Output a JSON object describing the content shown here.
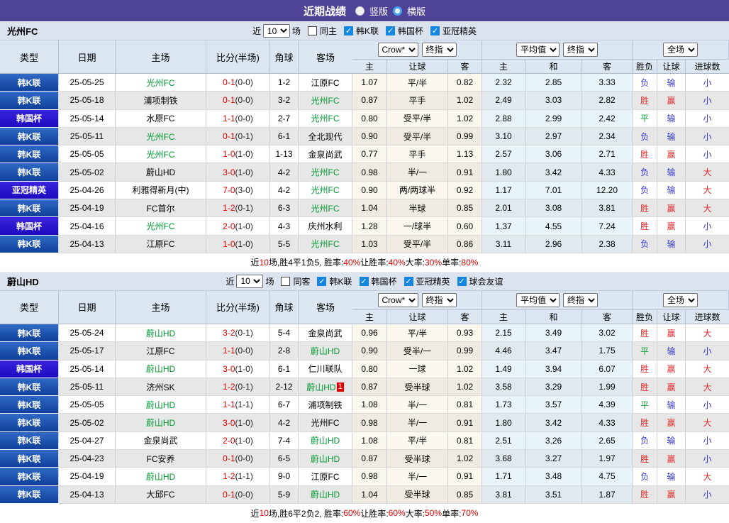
{
  "titlebar": {
    "title": "近期战绩",
    "radios": [
      {
        "label": "竖版",
        "selected": false,
        "id": "vertical-layout"
      },
      {
        "label": "横版",
        "selected": true,
        "id": "horizontal-layout"
      }
    ]
  },
  "table_header": {
    "cols": [
      "类型",
      "日期",
      "主场",
      "比分(半场)",
      "角球",
      "客场"
    ],
    "groups": [
      {
        "selects": [
          {
            "label": "Crow*",
            "id": "odds-company-select"
          },
          {
            "label": "终指",
            "id": "final-odds-select"
          }
        ]
      },
      {
        "selects": [
          {
            "label": "平均值",
            "id": "average-odds-select"
          },
          {
            "label": "终指",
            "id": "final-odds-select-2"
          }
        ]
      },
      {
        "selects": [
          {
            "label": "全场",
            "id": "scope-select"
          }
        ]
      }
    ],
    "subs": [
      "主",
      "让球",
      "客",
      "主",
      "和",
      "客",
      "胜负",
      "让球",
      "进球数"
    ]
  },
  "sections": [
    {
      "team": "光州FC",
      "filter": {
        "near": "近",
        "count": "10",
        "games": "场",
        "checkboxes": [
          {
            "label": "同主",
            "checked": false,
            "id": "same-home"
          },
          {
            "label": "韩K联",
            "checked": true,
            "id": "k-league"
          },
          {
            "label": "韩国杯",
            "checked": true,
            "id": "korea-cup"
          },
          {
            "label": "亚冠精英",
            "checked": true,
            "id": "acl-elite"
          }
        ]
      },
      "rows": [
        {
          "lg": "韩K联",
          "dt": "25-05-25",
          "hm": "光州FC",
          "hf": 1,
          "sc": "0-1",
          "ht": "(0-0)",
          "cn": "1-2",
          "aw": "江原FC",
          "af": 0,
          "bd": "",
          "o1": "1.07",
          "hc": "平/半",
          "o2": "0.82",
          "m1": "2.32",
          "m2": "2.85",
          "m3": "3.33",
          "r1": "负",
          "r2": "输",
          "r3": "小"
        },
        {
          "lg": "韩K联",
          "dt": "25-05-18",
          "hm": "浦项制铁",
          "hf": 0,
          "sc": "0-1",
          "ht": "(0-0)",
          "cn": "3-2",
          "aw": "光州FC",
          "af": 1,
          "bd": "",
          "o1": "0.87",
          "hc": "平手",
          "o2": "1.02",
          "m1": "2.49",
          "m2": "3.03",
          "m3": "2.82",
          "r1": "胜",
          "r2": "赢",
          "r3": "小"
        },
        {
          "lg": "韩国杯",
          "dt": "25-05-14",
          "hm": "水原FC",
          "hf": 0,
          "sc": "1-1",
          "ht": "(0-0)",
          "cn": "2-7",
          "aw": "光州FC",
          "af": 1,
          "bd": "",
          "o1": "0.80",
          "hc": "受平/半",
          "o2": "1.02",
          "m1": "2.88",
          "m2": "2.99",
          "m3": "2.42",
          "r1": "平",
          "r2": "输",
          "r3": "小"
        },
        {
          "lg": "韩K联",
          "dt": "25-05-11",
          "hm": "光州FC",
          "hf": 1,
          "sc": "0-1",
          "ht": "(0-1)",
          "cn": "6-1",
          "aw": "全北现代",
          "af": 0,
          "bd": "",
          "o1": "0.90",
          "hc": "受平/半",
          "o2": "0.99",
          "m1": "3.10",
          "m2": "2.97",
          "m3": "2.34",
          "r1": "负",
          "r2": "输",
          "r3": "小"
        },
        {
          "lg": "韩K联",
          "dt": "25-05-05",
          "hm": "光州FC",
          "hf": 1,
          "sc": "1-0",
          "ht": "(1-0)",
          "cn": "1-13",
          "aw": "金泉尚武",
          "af": 0,
          "bd": "",
          "o1": "0.77",
          "hc": "平手",
          "o2": "1.13",
          "m1": "2.57",
          "m2": "3.06",
          "m3": "2.71",
          "r1": "胜",
          "r2": "赢",
          "r3": "小"
        },
        {
          "lg": "韩K联",
          "dt": "25-05-02",
          "hm": "蔚山HD",
          "hf": 0,
          "sc": "3-0",
          "ht": "(1-0)",
          "cn": "4-2",
          "aw": "光州FC",
          "af": 1,
          "bd": "",
          "o1": "0.98",
          "hc": "半/一",
          "o2": "0.91",
          "m1": "1.80",
          "m2": "3.42",
          "m3": "4.33",
          "r1": "负",
          "r2": "输",
          "r3": "大"
        },
        {
          "lg": "亚冠精英",
          "dt": "25-04-26",
          "hm": "利雅得新月(中)",
          "hf": 0,
          "sc": "7-0",
          "ht": "(3-0)",
          "cn": "4-2",
          "aw": "光州FC",
          "af": 1,
          "bd": "",
          "o1": "0.90",
          "hc": "两/两球半",
          "o2": "0.92",
          "m1": "1.17",
          "m2": "7.01",
          "m3": "12.20",
          "r1": "负",
          "r2": "输",
          "r3": "大"
        },
        {
          "lg": "韩K联",
          "dt": "25-04-19",
          "hm": "FC首尔",
          "hf": 0,
          "sc": "1-2",
          "ht": "(0-1)",
          "cn": "6-3",
          "aw": "光州FC",
          "af": 1,
          "bd": "",
          "o1": "1.04",
          "hc": "半球",
          "o2": "0.85",
          "m1": "2.01",
          "m2": "3.08",
          "m3": "3.81",
          "r1": "胜",
          "r2": "赢",
          "r3": "大"
        },
        {
          "lg": "韩国杯",
          "dt": "25-04-16",
          "hm": "光州FC",
          "hf": 1,
          "sc": "2-0",
          "ht": "(1-0)",
          "cn": "4-3",
          "aw": "庆州水利",
          "af": 0,
          "bd": "",
          "o1": "1.28",
          "hc": "一/球半",
          "o2": "0.60",
          "m1": "1.37",
          "m2": "4.55",
          "m3": "7.24",
          "r1": "胜",
          "r2": "赢",
          "r3": "小"
        },
        {
          "lg": "韩K联",
          "dt": "25-04-13",
          "hm": "江原FC",
          "hf": 0,
          "sc": "1-0",
          "ht": "(1-0)",
          "cn": "5-5",
          "aw": "光州FC",
          "af": 1,
          "bd": "",
          "o1": "1.03",
          "hc": "受平/半",
          "o2": "0.86",
          "m1": "3.11",
          "m2": "2.96",
          "m3": "2.38",
          "r1": "负",
          "r2": "输",
          "r3": "小"
        }
      ],
      "summary": [
        [
          "近",
          0
        ],
        [
          "10",
          1
        ],
        [
          "场,胜4平1负5, 胜率:",
          0
        ],
        [
          "40%",
          1
        ],
        [
          " 让胜率:",
          0
        ],
        [
          "40%",
          1
        ],
        [
          " 大率:",
          0
        ],
        [
          "30%",
          1
        ],
        [
          " 单率:",
          0
        ],
        [
          "80%",
          1
        ]
      ]
    },
    {
      "team": "蔚山HD",
      "filter": {
        "near": "近",
        "count": "10",
        "games": "场",
        "checkboxes": [
          {
            "label": "同客",
            "checked": false,
            "id": "same-away"
          },
          {
            "label": "韩K联",
            "checked": true,
            "id": "k-league"
          },
          {
            "label": "韩国杯",
            "checked": true,
            "id": "korea-cup"
          },
          {
            "label": "亚冠精英",
            "checked": true,
            "id": "acl-elite"
          },
          {
            "label": "球会友谊",
            "checked": true,
            "id": "club-friendly"
          }
        ]
      },
      "rows": [
        {
          "lg": "韩K联",
          "dt": "25-05-24",
          "hm": "蔚山HD",
          "hf": 1,
          "sc": "3-2",
          "ht": "(0-1)",
          "cn": "5-4",
          "aw": "金泉尚武",
          "af": 0,
          "bd": "",
          "o1": "0.96",
          "hc": "平/半",
          "o2": "0.93",
          "m1": "2.15",
          "m2": "3.49",
          "m3": "3.02",
          "r1": "胜",
          "r2": "赢",
          "r3": "大"
        },
        {
          "lg": "韩K联",
          "dt": "25-05-17",
          "hm": "江原FC",
          "hf": 0,
          "sc": "1-1",
          "ht": "(0-0)",
          "cn": "2-8",
          "aw": "蔚山HD",
          "af": 1,
          "bd": "",
          "o1": "0.90",
          "hc": "受半/一",
          "o2": "0.99",
          "m1": "4.46",
          "m2": "3.47",
          "m3": "1.75",
          "r1": "平",
          "r2": "输",
          "r3": "小"
        },
        {
          "lg": "韩国杯",
          "dt": "25-05-14",
          "hm": "蔚山HD",
          "hf": 1,
          "sc": "3-0",
          "ht": "(1-0)",
          "cn": "6-1",
          "aw": "仁川联队",
          "af": 0,
          "bd": "",
          "o1": "0.80",
          "hc": "一球",
          "o2": "1.02",
          "m1": "1.49",
          "m2": "3.94",
          "m3": "6.07",
          "r1": "胜",
          "r2": "赢",
          "r3": "大"
        },
        {
          "lg": "韩K联",
          "dt": "25-05-11",
          "hm": "济州SK",
          "hf": 0,
          "sc": "1-2",
          "ht": "(0-1)",
          "cn": "2-12",
          "aw": "蔚山HD",
          "af": 1,
          "bd": "1",
          "o1": "0.87",
          "hc": "受半球",
          "o2": "1.02",
          "m1": "3.58",
          "m2": "3.29",
          "m3": "1.99",
          "r1": "胜",
          "r2": "赢",
          "r3": "大"
        },
        {
          "lg": "韩K联",
          "dt": "25-05-05",
          "hm": "蔚山HD",
          "hf": 1,
          "sc": "1-1",
          "ht": "(1-1)",
          "cn": "6-7",
          "aw": "浦项制铁",
          "af": 0,
          "bd": "",
          "o1": "1.08",
          "hc": "半/一",
          "o2": "0.81",
          "m1": "1.73",
          "m2": "3.57",
          "m3": "4.39",
          "r1": "平",
          "r2": "输",
          "r3": "小"
        },
        {
          "lg": "韩K联",
          "dt": "25-05-02",
          "hm": "蔚山HD",
          "hf": 1,
          "sc": "3-0",
          "ht": "(1-0)",
          "cn": "4-2",
          "aw": "光州FC",
          "af": 0,
          "bd": "",
          "o1": "0.98",
          "hc": "半/一",
          "o2": "0.91",
          "m1": "1.80",
          "m2": "3.42",
          "m3": "4.33",
          "r1": "胜",
          "r2": "赢",
          "r3": "大"
        },
        {
          "lg": "韩K联",
          "dt": "25-04-27",
          "hm": "金泉尚武",
          "hf": 0,
          "sc": "2-0",
          "ht": "(1-0)",
          "cn": "7-4",
          "aw": "蔚山HD",
          "af": 1,
          "bd": "",
          "o1": "1.08",
          "hc": "平/半",
          "o2": "0.81",
          "m1": "2.51",
          "m2": "3.26",
          "m3": "2.65",
          "r1": "负",
          "r2": "输",
          "r3": "小"
        },
        {
          "lg": "韩K联",
          "dt": "25-04-23",
          "hm": "FC安养",
          "hf": 0,
          "sc": "0-1",
          "ht": "(0-0)",
          "cn": "6-5",
          "aw": "蔚山HD",
          "af": 1,
          "bd": "",
          "o1": "0.87",
          "hc": "受半球",
          "o2": "1.02",
          "m1": "3.68",
          "m2": "3.27",
          "m3": "1.97",
          "r1": "胜",
          "r2": "赢",
          "r3": "小"
        },
        {
          "lg": "韩K联",
          "dt": "25-04-19",
          "hm": "蔚山HD",
          "hf": 1,
          "sc": "1-2",
          "ht": "(1-1)",
          "cn": "9-0",
          "aw": "江原FC",
          "af": 0,
          "bd": "",
          "o1": "0.98",
          "hc": "半/一",
          "o2": "0.91",
          "m1": "1.71",
          "m2": "3.48",
          "m3": "4.75",
          "r1": "负",
          "r2": "输",
          "r3": "大"
        },
        {
          "lg": "韩K联",
          "dt": "25-04-13",
          "hm": "大邱FC",
          "hf": 0,
          "sc": "0-1",
          "ht": "(0-0)",
          "cn": "5-9",
          "aw": "蔚山HD",
          "af": 1,
          "bd": "",
          "o1": "1.04",
          "hc": "受半球",
          "o2": "0.85",
          "m1": "3.81",
          "m2": "3.51",
          "m3": "1.87",
          "r1": "胜",
          "r2": "赢",
          "r3": "小"
        }
      ],
      "summary": [
        [
          "近",
          0
        ],
        [
          "10",
          1
        ],
        [
          "场,胜6平2负2, 胜率:",
          0
        ],
        [
          "60%",
          1
        ],
        [
          " 让胜率:",
          0
        ],
        [
          "60%",
          1
        ],
        [
          " 大率:",
          0
        ],
        [
          "50%",
          1
        ],
        [
          " 单率:",
          0
        ],
        [
          "70%",
          1
        ]
      ]
    }
  ]
}
